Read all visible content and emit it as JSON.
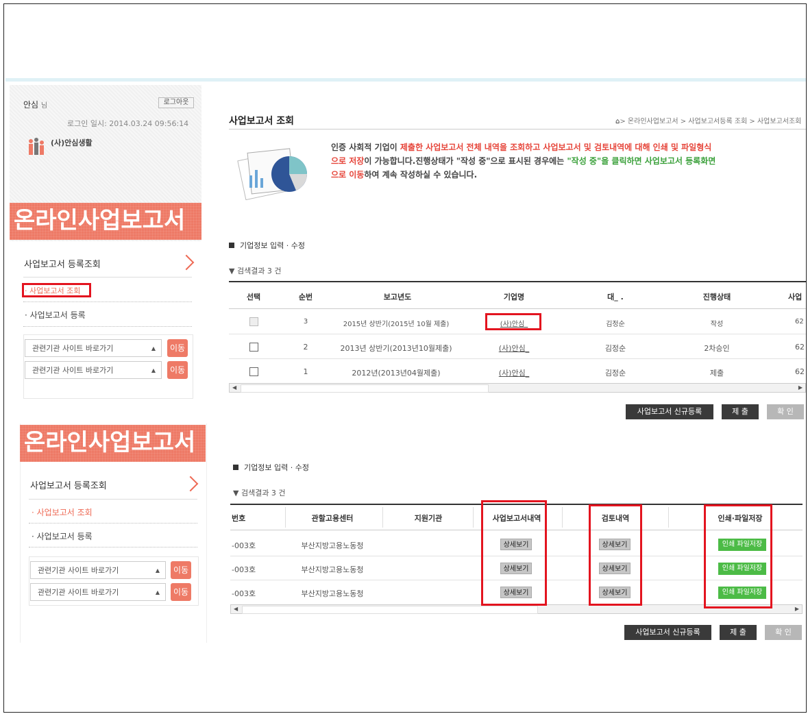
{
  "user": {
    "name": "안심",
    "suffix": "님",
    "logout": "로그아웃",
    "login_time": "로그인 일시: 2014.03.24  09:56:14",
    "company": "(사)안심생활"
  },
  "banner": {
    "title": "온라인사업보고서"
  },
  "sidebar": {
    "menu_title": "사업보고서 등록조회",
    "items": [
      {
        "label": "· 사업보고서 조회"
      },
      {
        "label": "· 사업보고서 등록"
      }
    ],
    "selects": [
      {
        "label": "관련기관 사이트 바로가기",
        "go": "이동"
      },
      {
        "label": "관련기관 사이트 바로가기",
        "go": "이동"
      }
    ]
  },
  "page": {
    "title": "사업보고서 조회",
    "breadcrumb": "> 온라인사업보고서 > 사업보고서등록 조회 > 사업보고서조회",
    "intro": {
      "p1": "인증 사회적 기업이 ",
      "p2": "제출한 사업보고서 전체 내역을 조회하고 사업보고서 및 검토내역에 대해 인쇄 및 파일형식",
      "p3": "으로 저장",
      "p4": "이 가능합니다.진행상태가 \"작성 중\"으로 표시된 경우에는 ",
      "p5": "\"작성 중\"을 클릭하면 사업보고서 등록화면",
      "p6": "으로 이동",
      "p7": "하여 계속 작성하실 수 있습니다."
    }
  },
  "section1": {
    "heading": "기업정보 입력 · 수정",
    "result": "▼ 검색결과 3 건",
    "columns": [
      "선택",
      "순번",
      "보고년도",
      "기업명",
      "대_ .",
      "진행상태",
      "사업"
    ],
    "rows": [
      {
        "no": "3",
        "year": "2015년 상반기(2015년 10월 제출)",
        "company": "(사)안심_",
        "rep": "김정순",
        "status": "작성",
        "extra": "62"
      },
      {
        "no": "2",
        "year": "2013년 상반기(2013년10월제출)",
        "company": "(사)안심_",
        "rep": "김정순",
        "status": "2차승인",
        "extra": "62"
      },
      {
        "no": "1",
        "year": "2012년(2013년04월제출)",
        "company": "(사)안심_",
        "rep": "김정순",
        "status": "제출",
        "extra": "62"
      }
    ],
    "buttons": {
      "register": "사업보고서 신규등록",
      "submit": "제 출",
      "confirm": "확 인"
    }
  },
  "section2": {
    "heading": "기업정보 입력 · 수정",
    "result": "▼ 검색결과 3 건",
    "columns": [
      "번호",
      "관할고용센터",
      "지원기관",
      "사업보고서내역",
      "검토내역",
      "인쇄·파일저장"
    ],
    "rows": [
      {
        "no": "-003호",
        "center": "부산지방고용노동청",
        "detail": "상세보기",
        "review": "상세보기",
        "print": "인쇄 파일저장"
      },
      {
        "no": "-003호",
        "center": "부산지방고용노동청",
        "detail": "상세보기",
        "review": "상세보기",
        "print": "인쇄 파일저장"
      },
      {
        "no": "-003호",
        "center": "부산지방고용노동청",
        "detail": "상세보기",
        "review": "상세보기",
        "print": "인쇄 파일저장"
      }
    ],
    "buttons": {
      "register": "사업보고서 신규등록",
      "submit": "제 출",
      "confirm": "확 인"
    }
  },
  "colors": {
    "accent": "#ee7a66",
    "highlight": "#e3141f",
    "green": "#4cbb46",
    "red_text": "#e6453a"
  }
}
